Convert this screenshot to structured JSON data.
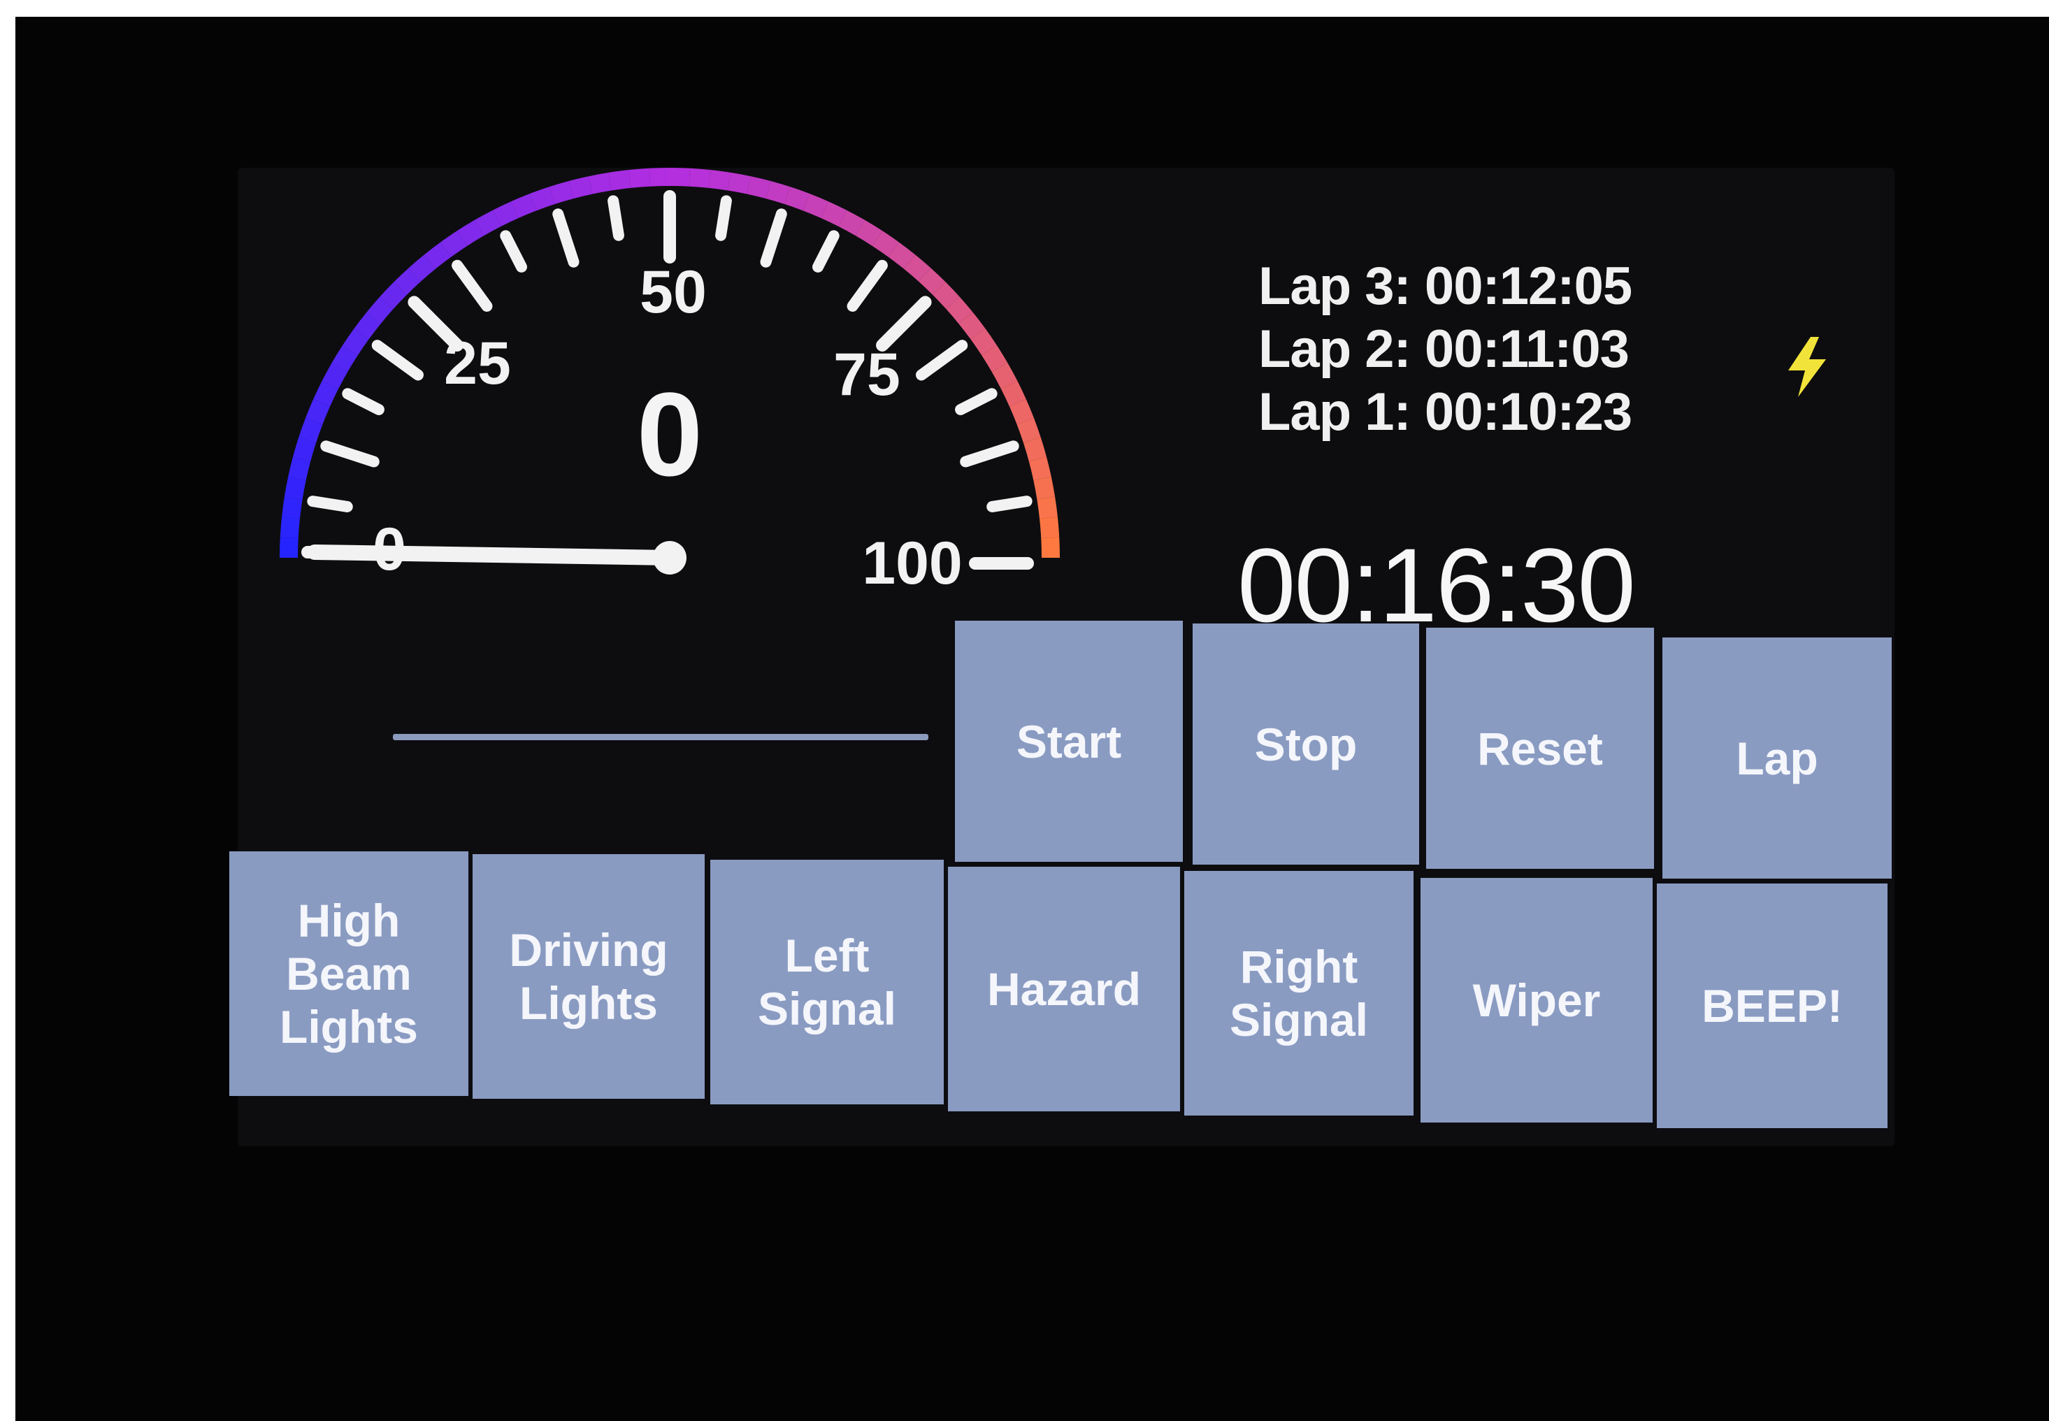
{
  "gauge": {
    "value": "0",
    "min": 0,
    "max": 100,
    "labels": [
      "0",
      "25",
      "50",
      "75",
      "100"
    ],
    "colors": {
      "arc_start": "#2323ff",
      "arc_mid": "#b32ee0",
      "arc_end": "#ff7a3c",
      "needle": "#f2f2f2"
    }
  },
  "laps": [
    "Lap 3: 00:12:05",
    "Lap 2: 00:11:03",
    "Lap 1: 00:10:23"
  ],
  "timer": "00:16:30",
  "status_icon": {
    "name": "lightning-bolt-icon",
    "color": "#f2e33a"
  },
  "stopwatch_buttons": [
    "Start",
    "Stop",
    "Reset",
    "Lap"
  ],
  "control_buttons": [
    "High Beam Lights",
    "Driving Lights",
    "Left Signal",
    "Hazard",
    "Right Signal",
    "Wiper",
    "BEEP!"
  ],
  "button_color": "#8a9bc2"
}
